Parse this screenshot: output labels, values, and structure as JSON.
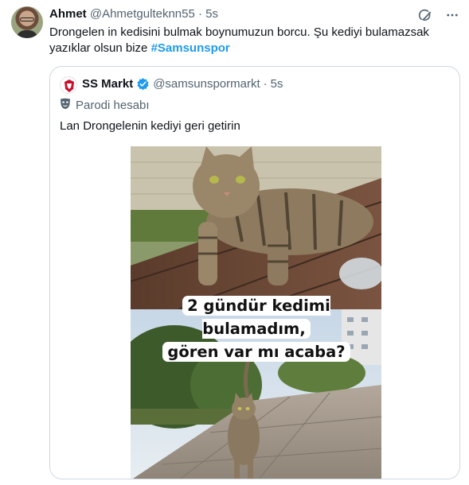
{
  "author": {
    "name": "Ahmet",
    "handle": "@Ahmetgulteknn55",
    "separator": "·",
    "time": "5s"
  },
  "tweet": {
    "text": "Drongelen in kedisini bulmak boynumuzun borcu. Şu kediyi bulamazsak yazıklar olsun bize ",
    "hashtag": "#Samsunspor"
  },
  "quote": {
    "name": "SS Markt",
    "handle": "@samsunspormarkt",
    "separator": "·",
    "time": "5s",
    "label": "Parodi hesabı",
    "text": "Lan Drongelenin kediyi geri getirin",
    "media": {
      "caption_line1": "2 gündür kedimi bulamadım,",
      "caption_line2": "gören var mı acaba?"
    }
  },
  "colors": {
    "link": "#1d9bf0",
    "muted": "#536471",
    "border": "#cfd9de"
  },
  "icons": [
    "grok-icon",
    "more-icon",
    "verified-badge-icon",
    "parody-mask-icon"
  ]
}
